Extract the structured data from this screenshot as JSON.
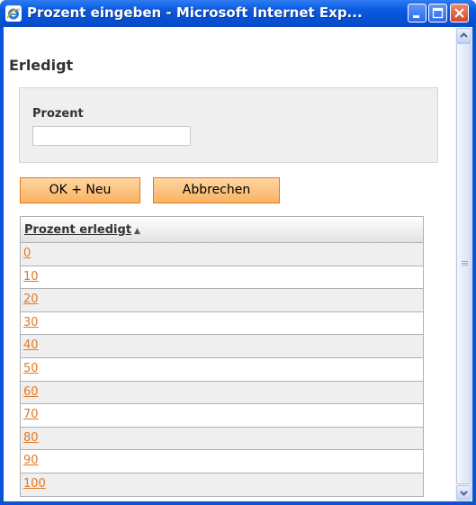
{
  "window": {
    "title": "Prozent eingeben - Microsoft Internet Exp...",
    "controls": {
      "minimize": "minimize-icon",
      "maximize": "maximize-icon",
      "close": "close-icon"
    }
  },
  "page": {
    "heading": "Erledigt",
    "field": {
      "label": "Prozent",
      "value": "",
      "placeholder": ""
    },
    "buttons": {
      "ok_new": "OK + Neu",
      "cancel": "Abbrechen"
    }
  },
  "table": {
    "header": "Prozent erledigt",
    "sort_icon": "sort-ascending-icon",
    "rows": [
      "0",
      "10",
      "20",
      "30",
      "40",
      "50",
      "60",
      "70",
      "80",
      "90",
      "100"
    ]
  },
  "colors": {
    "titlebar": "#0650d2",
    "button_orange": "#f9b260",
    "link_orange": "#e5791f",
    "row_alt": "#efefef"
  }
}
